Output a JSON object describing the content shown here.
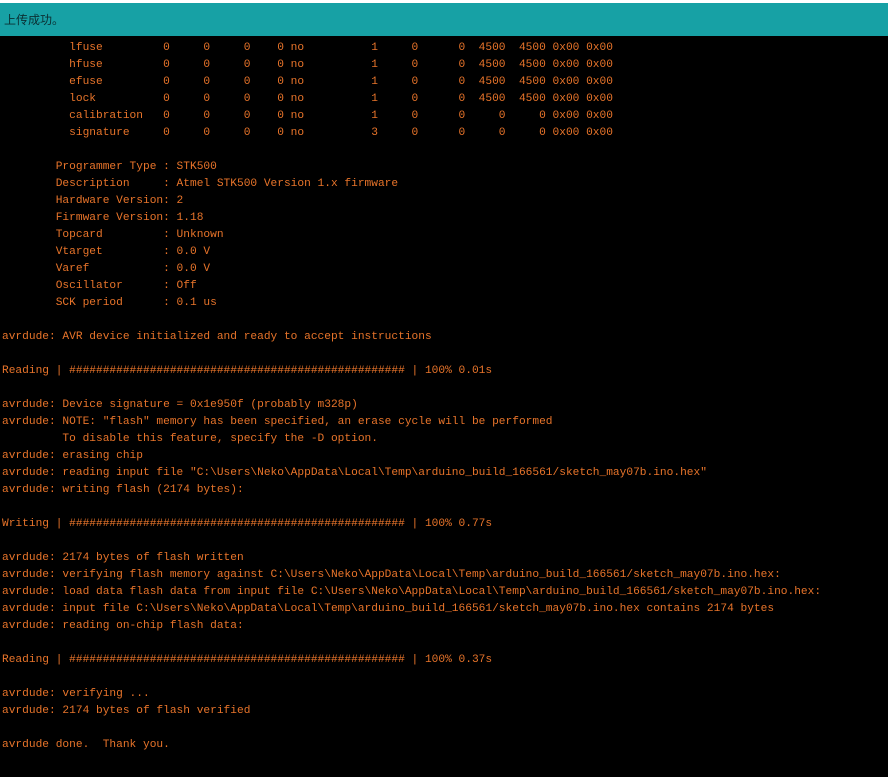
{
  "status": {
    "message": "上传成功。"
  },
  "console": {
    "lines": [
      "          lfuse         0     0     0    0 no          1     0      0  4500  4500 0x00 0x00",
      "          hfuse         0     0     0    0 no          1     0      0  4500  4500 0x00 0x00",
      "          efuse         0     0     0    0 no          1     0      0  4500  4500 0x00 0x00",
      "          lock          0     0     0    0 no          1     0      0  4500  4500 0x00 0x00",
      "          calibration   0     0     0    0 no          1     0      0     0     0 0x00 0x00",
      "          signature     0     0     0    0 no          3     0      0     0     0 0x00 0x00",
      "",
      "        Programmer Type : STK500",
      "        Description     : Atmel STK500 Version 1.x firmware",
      "        Hardware Version: 2",
      "        Firmware Version: 1.18",
      "        Topcard         : Unknown",
      "        Vtarget         : 0.0 V",
      "        Varef           : 0.0 V",
      "        Oscillator      : Off",
      "        SCK period      : 0.1 us",
      "",
      "avrdude: AVR device initialized and ready to accept instructions",
      "",
      "Reading | ################################################## | 100% 0.01s",
      "",
      "avrdude: Device signature = 0x1e950f (probably m328p)",
      "avrdude: NOTE: \"flash\" memory has been specified, an erase cycle will be performed",
      "         To disable this feature, specify the -D option.",
      "avrdude: erasing chip",
      "avrdude: reading input file \"C:\\Users\\Neko\\AppData\\Local\\Temp\\arduino_build_166561/sketch_may07b.ino.hex\"",
      "avrdude: writing flash (2174 bytes):",
      "",
      "Writing | ################################################## | 100% 0.77s",
      "",
      "avrdude: 2174 bytes of flash written",
      "avrdude: verifying flash memory against C:\\Users\\Neko\\AppData\\Local\\Temp\\arduino_build_166561/sketch_may07b.ino.hex:",
      "avrdude: load data flash data from input file C:\\Users\\Neko\\AppData\\Local\\Temp\\arduino_build_166561/sketch_may07b.ino.hex:",
      "avrdude: input file C:\\Users\\Neko\\AppData\\Local\\Temp\\arduino_build_166561/sketch_may07b.ino.hex contains 2174 bytes",
      "avrdude: reading on-chip flash data:",
      "",
      "Reading | ################################################## | 100% 0.37s",
      "",
      "avrdude: verifying ...",
      "avrdude: 2174 bytes of flash verified",
      "",
      "avrdude done.  Thank you."
    ]
  }
}
